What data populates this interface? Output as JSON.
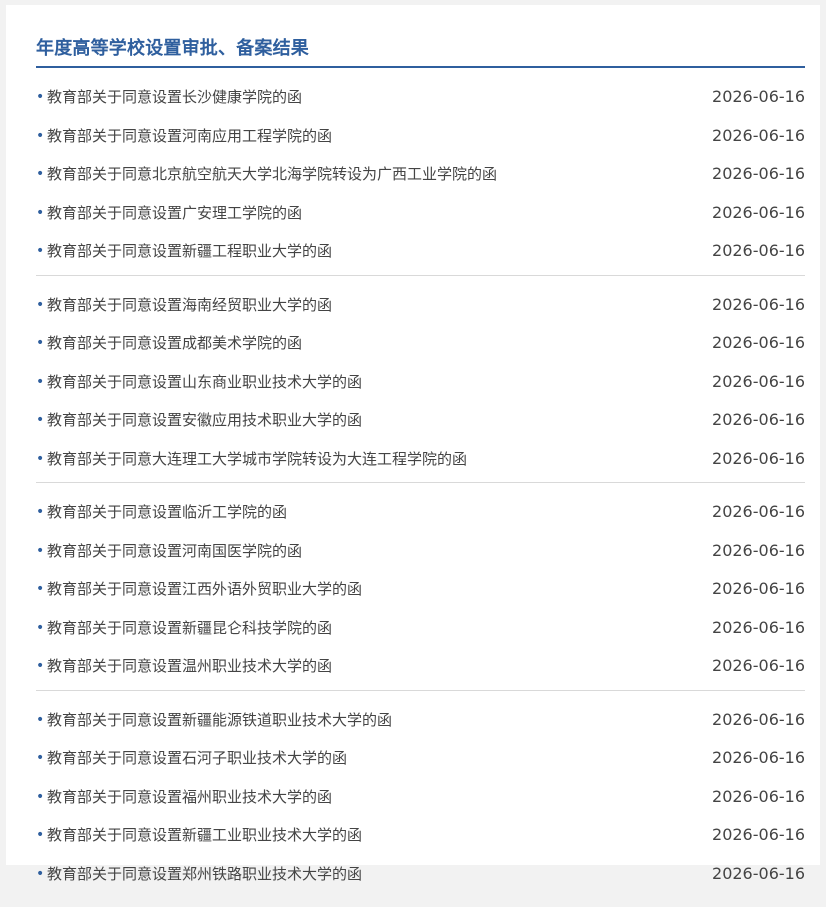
{
  "section": {
    "title": "年度高等学校设置审批、备案结果"
  },
  "groups": [
    [
      {
        "title": "教育部关于同意设置长沙健康学院的函",
        "date": "2026-06-16"
      },
      {
        "title": "教育部关于同意设置河南应用工程学院的函",
        "date": "2026-06-16"
      },
      {
        "title": "教育部关于同意北京航空航天大学北海学院转设为广西工业学院的函",
        "date": "2026-06-16"
      },
      {
        "title": "教育部关于同意设置广安理工学院的函",
        "date": "2026-06-16"
      },
      {
        "title": "教育部关于同意设置新疆工程职业大学的函",
        "date": "2026-06-16"
      }
    ],
    [
      {
        "title": "教育部关于同意设置海南经贸职业大学的函",
        "date": "2026-06-16"
      },
      {
        "title": "教育部关于同意设置成都美术学院的函",
        "date": "2026-06-16"
      },
      {
        "title": "教育部关于同意设置山东商业职业技术大学的函",
        "date": "2026-06-16"
      },
      {
        "title": "教育部关于同意设置安徽应用技术职业大学的函",
        "date": "2026-06-16"
      },
      {
        "title": "教育部关于同意大连理工大学城市学院转设为大连工程学院的函",
        "date": "2026-06-16"
      }
    ],
    [
      {
        "title": "教育部关于同意设置临沂工学院的函",
        "date": "2026-06-16"
      },
      {
        "title": "教育部关于同意设置河南国医学院的函",
        "date": "2026-06-16"
      },
      {
        "title": "教育部关于同意设置江西外语外贸职业大学的函",
        "date": "2026-06-16"
      },
      {
        "title": "教育部关于同意设置新疆昆仑科技学院的函",
        "date": "2026-06-16"
      },
      {
        "title": "教育部关于同意设置温州职业技术大学的函",
        "date": "2026-06-16"
      }
    ],
    [
      {
        "title": "教育部关于同意设置新疆能源铁道职业技术大学的函",
        "date": "2026-06-16"
      },
      {
        "title": "教育部关于同意设置石河子职业技术大学的函",
        "date": "2026-06-16"
      },
      {
        "title": "教育部关于同意设置福州职业技术大学的函",
        "date": "2026-06-16"
      },
      {
        "title": "教育部关于同意设置新疆工业职业技术大学的函",
        "date": "2026-06-16"
      },
      {
        "title": "教育部关于同意设置郑州铁路职业技术大学的函",
        "date": "2026-06-16"
      }
    ]
  ],
  "icons": {
    "bullet": "dot-bullet-icon",
    "bullet_glyph": "•",
    "accent_color": "#2f5f9e"
  }
}
